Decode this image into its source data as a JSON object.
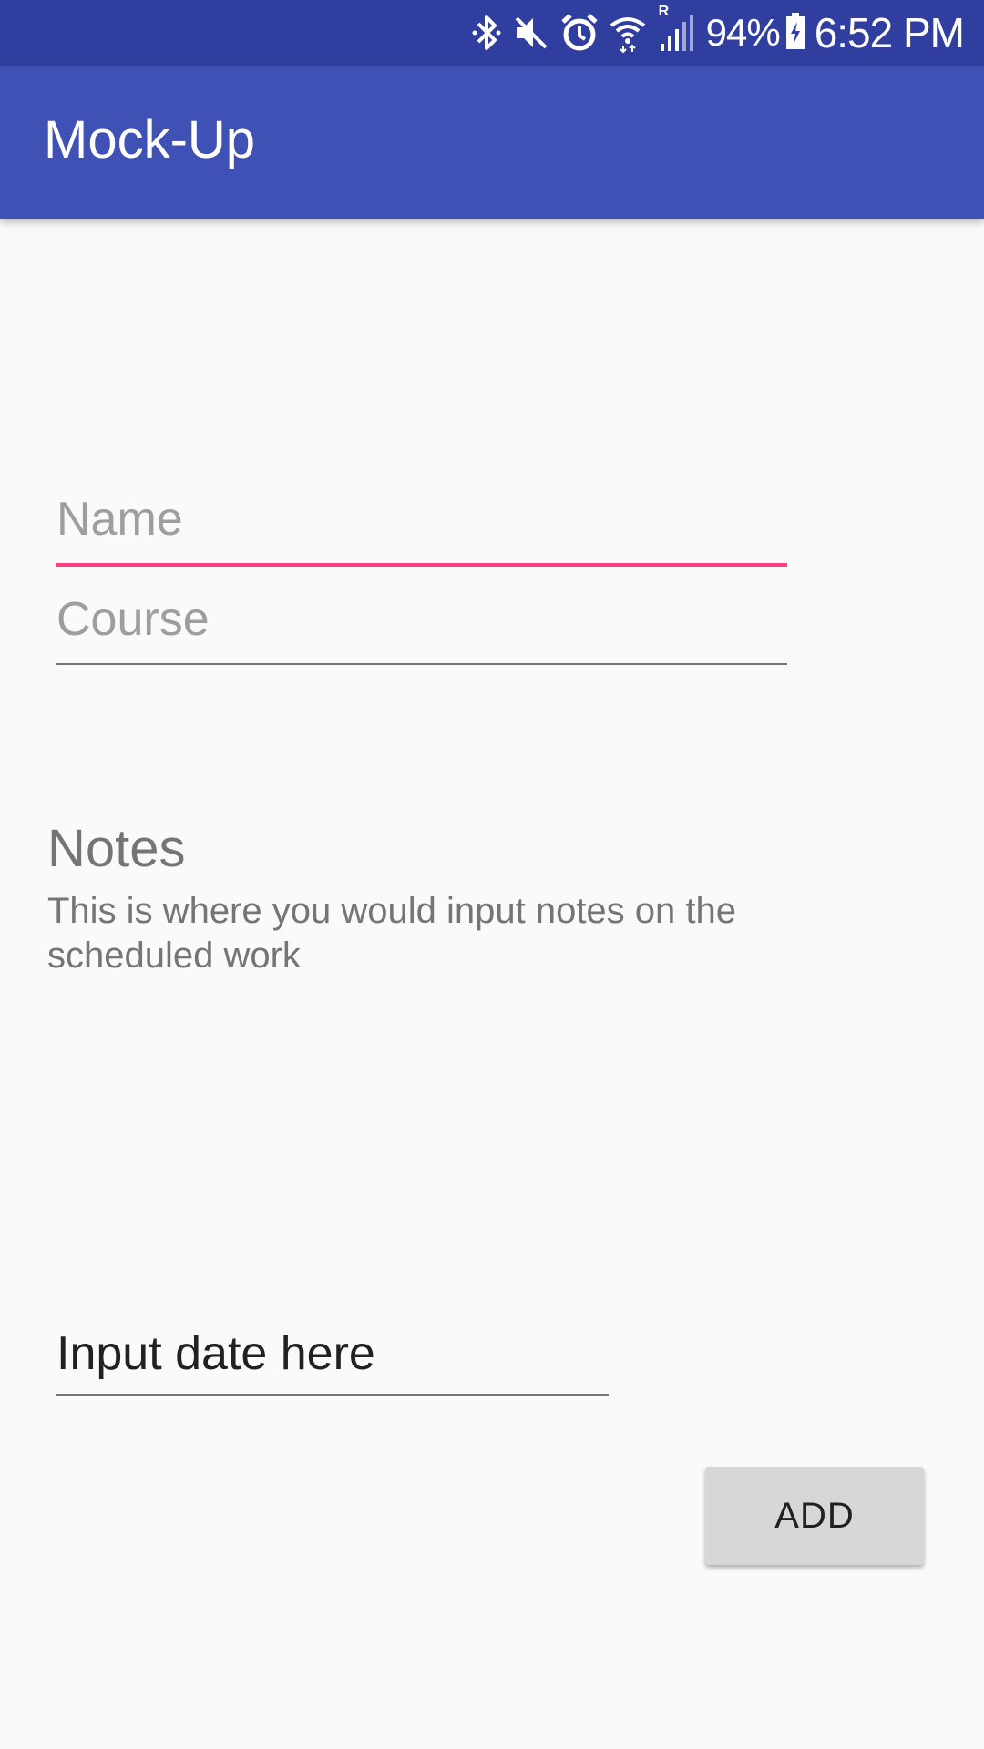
{
  "status_bar": {
    "icons": [
      "bluetooth-icon",
      "mute-icon",
      "alarm-icon",
      "wifi-icon",
      "signal-icon",
      "battery-icon"
    ],
    "roaming_indicator": "R",
    "battery_percent": "94%",
    "time": "6:52 PM"
  },
  "app_bar": {
    "title": "Mock-Up"
  },
  "form": {
    "name_placeholder": "Name",
    "course_placeholder": "Course",
    "notes_title": "Notes",
    "notes_text": "This is where you would input notes on the scheduled work",
    "date_value": "Input date here",
    "add_label": "ADD"
  },
  "colors": {
    "status_bar": "#303f9f",
    "app_bar": "#3f51b5",
    "accent": "#ff4081",
    "background": "#fafafa",
    "button": "#d6d7d7"
  }
}
